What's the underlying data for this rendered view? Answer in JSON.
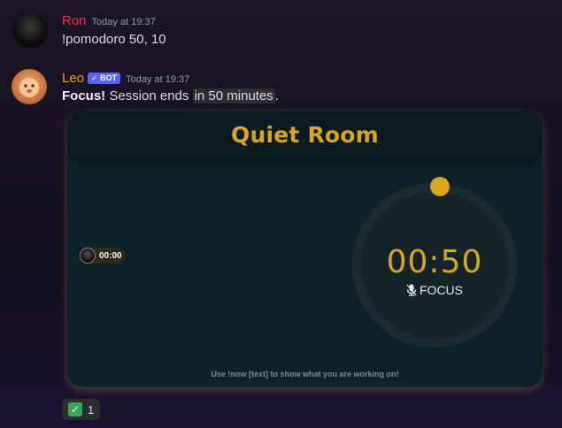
{
  "messages": [
    {
      "author": "Ron",
      "timestamp": "Today at 19:37",
      "content": "!pomodoro 50, 10",
      "author_color": "#e8384f"
    },
    {
      "author": "Leo",
      "bot_badge": "✓ BOT",
      "timestamp": "Today at 19:37",
      "content_bold": "Focus!",
      "content_text": "Session ends",
      "content_code": "in 50 minutes",
      "content_end": ".",
      "author_color": "#e3a23f"
    }
  ],
  "card": {
    "title": "Quiet Room",
    "member_time": "00:00",
    "timer": "00:50",
    "stage": "FOCUS",
    "footer": "Use !now [text] to show what you are working on!",
    "accent_color": "#d9a61c",
    "progress": 0.0
  },
  "reaction": {
    "emoji": "check-mark-icon",
    "count": "1"
  }
}
